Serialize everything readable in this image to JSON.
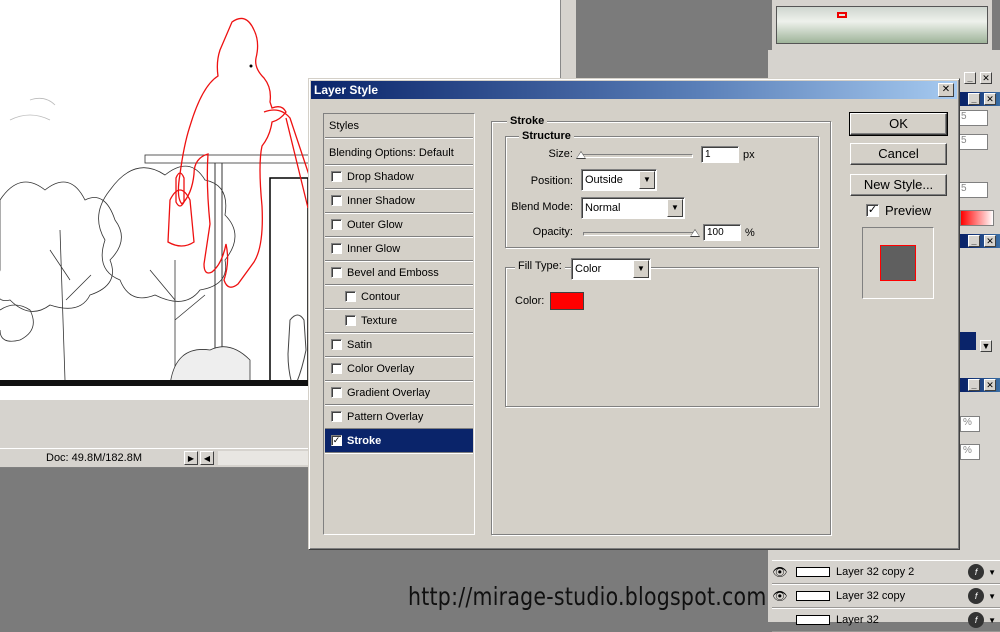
{
  "document": {
    "status_text": "Doc: 49.8M/182.8M"
  },
  "dialog": {
    "title": "Layer Style",
    "close_glyph": "✕",
    "style_list": {
      "styles_label": "Styles",
      "blending_label": "Blending Options: Default",
      "effects": [
        {
          "label": "Drop Shadow",
          "checked": false,
          "indent": false
        },
        {
          "label": "Inner Shadow",
          "checked": false,
          "indent": false
        },
        {
          "label": "Outer Glow",
          "checked": false,
          "indent": false
        },
        {
          "label": "Inner Glow",
          "checked": false,
          "indent": false
        },
        {
          "label": "Bevel and Emboss",
          "checked": false,
          "indent": false
        },
        {
          "label": "Contour",
          "checked": false,
          "indent": true
        },
        {
          "label": "Texture",
          "checked": false,
          "indent": true
        },
        {
          "label": "Satin",
          "checked": false,
          "indent": false
        },
        {
          "label": "Color Overlay",
          "checked": false,
          "indent": false
        },
        {
          "label": "Gradient Overlay",
          "checked": false,
          "indent": false
        },
        {
          "label": "Pattern Overlay",
          "checked": false,
          "indent": false
        },
        {
          "label": "Stroke",
          "checked": true,
          "indent": false,
          "selected": true
        }
      ]
    },
    "stroke": {
      "section_title": "Stroke",
      "structure_title": "Structure",
      "size_label": "Size:",
      "size_value": "1",
      "size_unit": "px",
      "size_slider_fraction": 0.0,
      "position_label": "Position:",
      "position_value": "Outside",
      "blend_mode_label": "Blend Mode:",
      "blend_mode_value": "Normal",
      "opacity_label": "Opacity:",
      "opacity_value": "100",
      "opacity_unit": "%",
      "opacity_slider_fraction": 1.0,
      "fill_type_label": "Fill Type:",
      "fill_type_value": "Color",
      "color_label": "Color:",
      "color_value": "#ff0000"
    },
    "buttons": {
      "ok": "OK",
      "cancel": "Cancel",
      "new_style": "New Style..."
    },
    "preview": {
      "label": "Preview",
      "checked": true,
      "swatch_fill": "#5f5f5f",
      "swatch_stroke": "#ff0000"
    }
  },
  "layers": [
    {
      "name": "Layer 32 copy 2",
      "visible": true
    },
    {
      "name": "Layer 32 copy",
      "visible": true
    },
    {
      "name": "Layer 32",
      "visible": false
    }
  ],
  "palette_fields": {
    "field_s": "5",
    "field_pct": "%"
  },
  "watermark": "http://mirage-studio.blogspot.com"
}
